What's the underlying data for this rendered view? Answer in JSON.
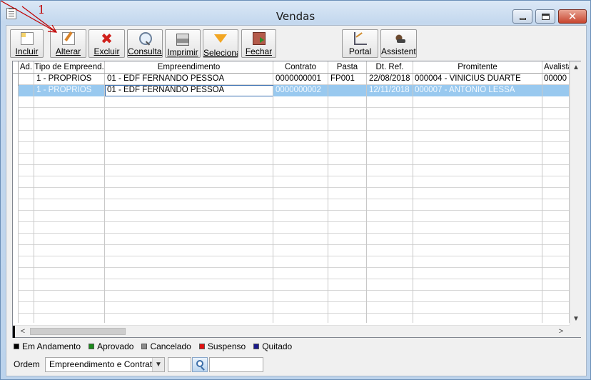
{
  "window": {
    "title": "Vendas"
  },
  "annotation": {
    "number": "1"
  },
  "toolbar": {
    "incluir": "Incluir",
    "alterar": "Alterar",
    "excluir": "Excluir",
    "consultar": "Consultar",
    "imprimir": "Imprimir",
    "selecionar": "Seleciona",
    "fechar": "Fechar",
    "portal": "Portal",
    "assistente": "Assistente"
  },
  "grid": {
    "columns": [
      "Ad.",
      "Tipo de Empreend.",
      "Empreendimento",
      "Contrato",
      "Pasta",
      "Dt. Ref.",
      "Promitente",
      "Avalista"
    ],
    "rows": [
      {
        "ad": "",
        "tipo": "1 - PROPRIOS",
        "empreendimento": "01 - EDF FERNANDO PESSOA",
        "contrato": "0000000001",
        "pasta": "FP001",
        "dt_ref": "22/08/2018",
        "promitente": "000004 - VINICIUS DUARTE",
        "avalista": "00000"
      },
      {
        "ad": "",
        "tipo": "1 - PROPRIOS",
        "empreendimento": "01 - EDF FERNANDO PESSOA",
        "contrato": "0000000002",
        "pasta": "",
        "dt_ref": "12/11/2018",
        "promitente": "000007 - ANTONIO LESSA",
        "avalista": ""
      }
    ]
  },
  "legend": {
    "em_andamento": {
      "label": "Em Andamento",
      "color": "#000000"
    },
    "aprovado": {
      "label": "Aprovado",
      "color": "#1a8a1a"
    },
    "cancelado": {
      "label": "Cancelado",
      "color": "#8c8c8c"
    },
    "suspenso": {
      "label": "Suspenso",
      "color": "#e01010"
    },
    "quitado": {
      "label": "Quitado",
      "color": "#1a1a8c"
    }
  },
  "ordem": {
    "label": "Ordem",
    "selected": "Empreendimento e Contrato"
  }
}
